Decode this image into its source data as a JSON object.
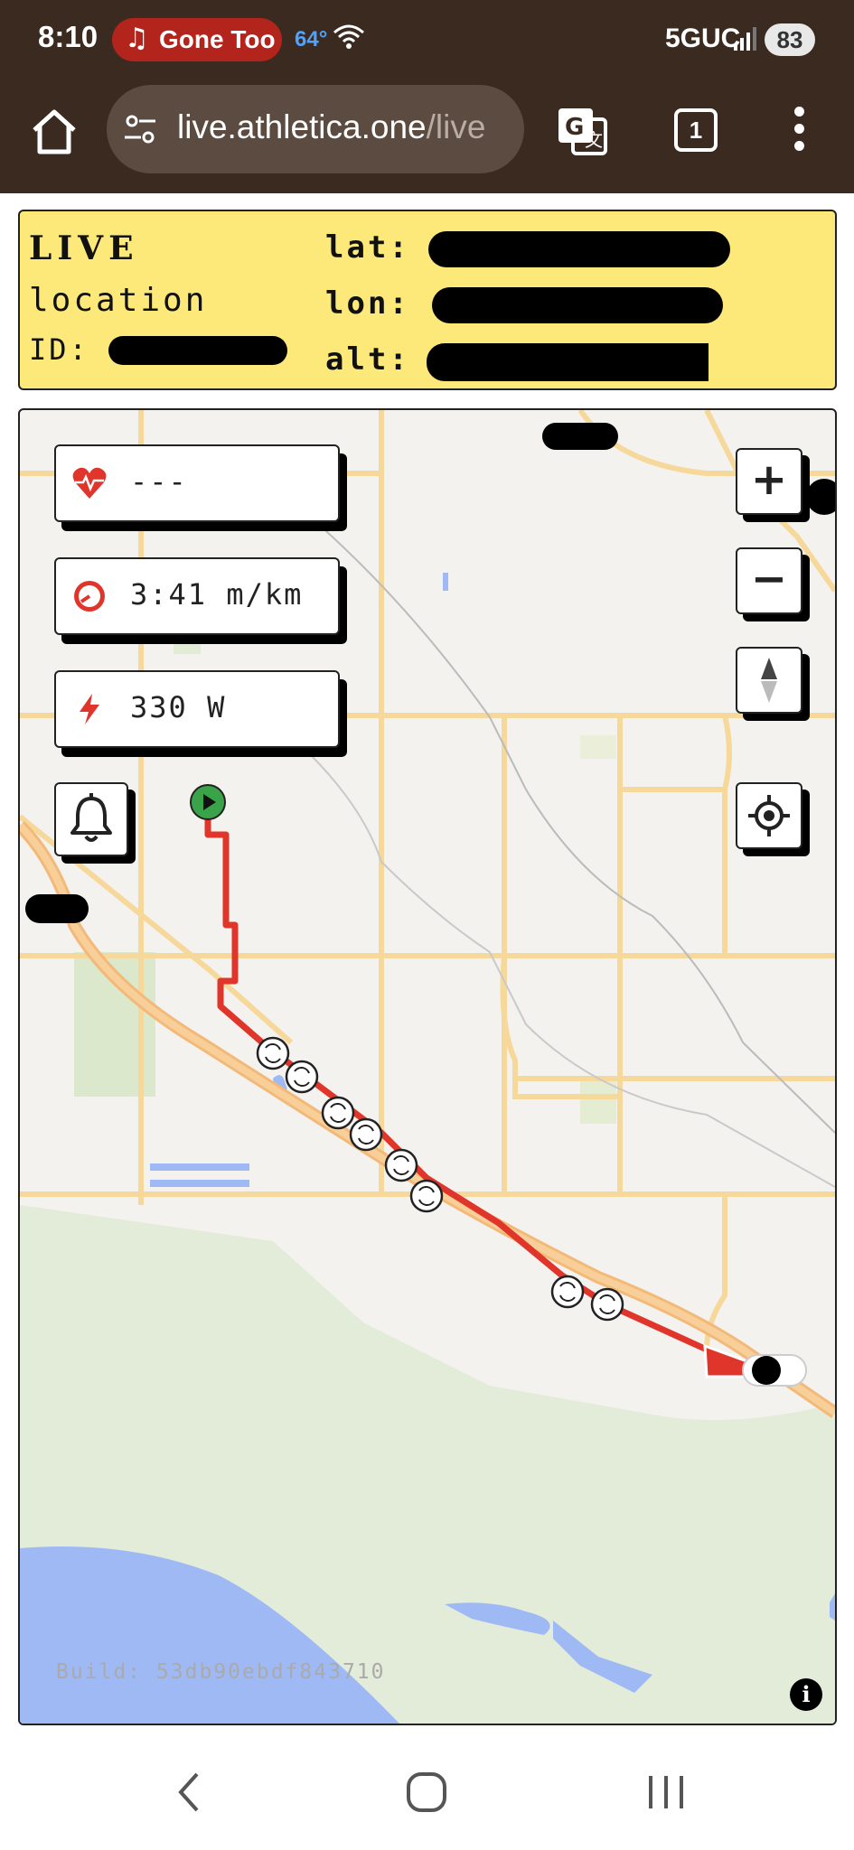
{
  "status_bar": {
    "time": "8:10",
    "media_label": "Gone Too",
    "temperature": "64°",
    "network": "5GUC",
    "battery": "83"
  },
  "browser": {
    "url_main": "live.athletica.one",
    "url_rest": "/live",
    "tab_count": "1"
  },
  "info_panel": {
    "title_live": "LIVE",
    "title_location": "location",
    "id_label": "ID:",
    "lat_label": "lat:",
    "lon_label": "lon:",
    "alt_label": "alt:"
  },
  "metrics": {
    "heart_rate": "---",
    "pace": "3:41 m/km",
    "power": "330 W"
  },
  "map_controls": {
    "zoom_in": "+",
    "zoom_out": "−"
  },
  "build": "Build: 53db90ebdf843710",
  "info_button": "i",
  "colors": {
    "status_bg": "#3b2a20",
    "panel_yellow": "#fde97a",
    "route_red": "#e0352b",
    "start_green": "#3aa34a"
  }
}
